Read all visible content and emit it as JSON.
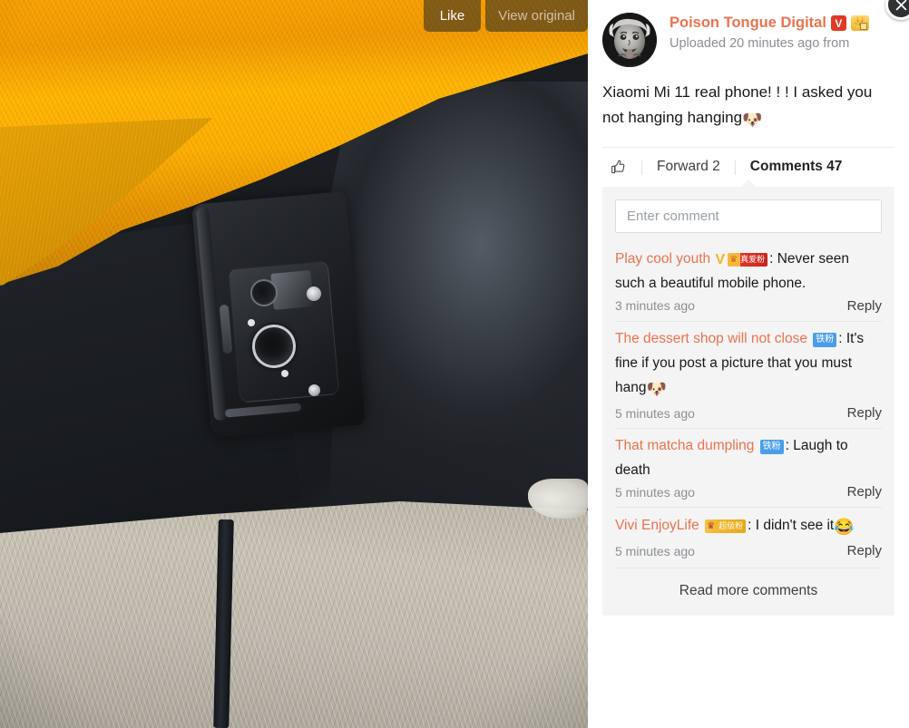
{
  "photo": {
    "like_label": "Like",
    "view_original_label": "View original",
    "alt_description": "Close-up photo of a black smartphone with a large round camera module tucked between a yellow knit sweater and a dark navy jacket, resting above a grey carpet with a black chair leg"
  },
  "panel": {
    "close_icon": "close-icon"
  },
  "author": {
    "name": "Poison Tongue Digital",
    "verified_badge": "V",
    "crown_badge": "👑",
    "upload_time": "Uploaded 20 minutes ago",
    "from_label": "from",
    "avatar_icon": "einstein-avatar"
  },
  "post": {
    "text": "Xiaomi Mi 11 real phone! ! ! I asked you not hanging hanging",
    "emoji": "🐶"
  },
  "actions": {
    "like_icon": "thumbs-up-icon",
    "forward_label": "Forward 2",
    "comments_label": "Comments 47"
  },
  "comment_box": {
    "placeholder": "Enter comment",
    "value": ""
  },
  "comments": [
    {
      "name": "Play cool youth",
      "badges": [
        "V",
        "真爱粉"
      ],
      "badge_types": [
        "v-yellow",
        "red-fan"
      ],
      "text": ": Never seen such a beautiful mobile phone.",
      "emoji": "",
      "time": "3 minutes ago",
      "reply_label": "Reply"
    },
    {
      "name": "The dessert shop will not close",
      "badges": [
        "铁粉"
      ],
      "badge_types": [
        "blue-fan"
      ],
      "text": ":  It's fine if you post a picture that you must hang",
      "emoji": "🐶",
      "time": "5 minutes ago",
      "reply_label": "Reply"
    },
    {
      "name": "That matcha dumpling",
      "badges": [
        "铁粉"
      ],
      "badge_types": [
        "blue-fan"
      ],
      "text": ": Laugh to death",
      "emoji": "",
      "time": "5 minutes ago",
      "reply_label": "Reply"
    },
    {
      "name": "Vivi EnjoyLife",
      "badges": [
        "超级粉"
      ],
      "badge_types": [
        "gold-fan"
      ],
      "text": ": I didn't see it",
      "emoji": "😂",
      "time": "5 minutes ago",
      "reply_label": "Reply"
    }
  ],
  "read_more": {
    "label": "Read more comments"
  },
  "colors": {
    "accent_name": "#eb7350",
    "verified_red": "#e03a24",
    "panel_bg": "#f4f4f4",
    "text_primary": "#16191c",
    "text_muted": "#8a8f94",
    "blue_fan_badge": "#4a9ee8",
    "gold_badge": "#f0b429"
  }
}
